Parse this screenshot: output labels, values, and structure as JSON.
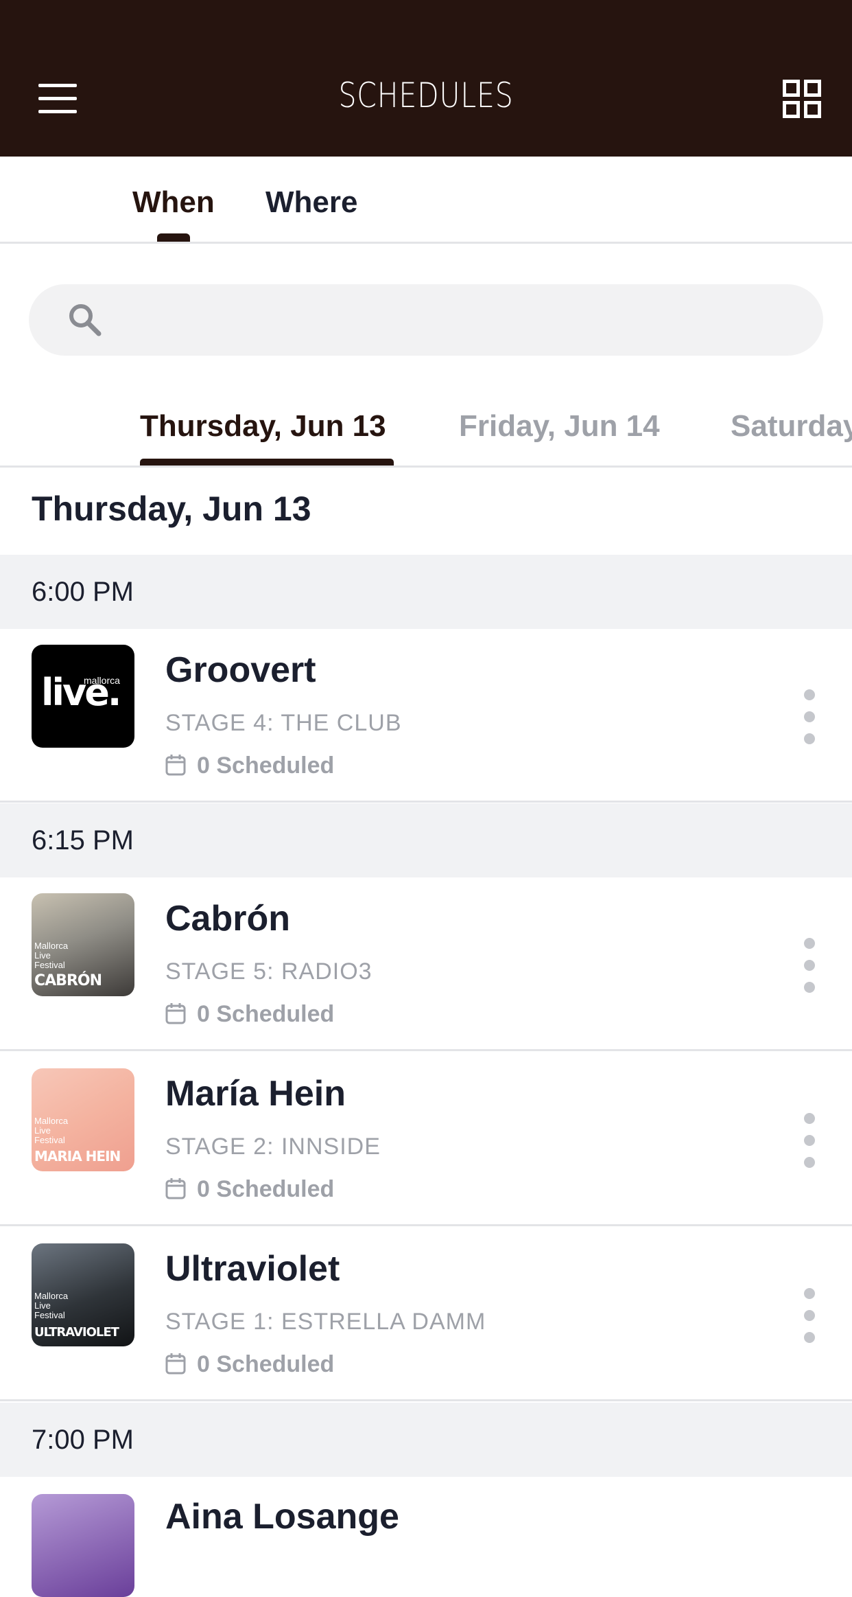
{
  "header": {
    "title": "SCHEDULES",
    "menu_icon": "hamburger-menu-icon",
    "grid_icon": "grid-view-icon",
    "background": "#26140f"
  },
  "mode_tabs": [
    {
      "label": "When",
      "active": true
    },
    {
      "label": "Where",
      "active": false
    }
  ],
  "search": {
    "placeholder": "",
    "value": ""
  },
  "day_tabs": [
    {
      "label": "Thursday, Jun 13",
      "active": true
    },
    {
      "label": "Friday, Jun 14",
      "active": false
    },
    {
      "label": "Saturday",
      "active": false
    }
  ],
  "day_heading": "Thursday, Jun 13",
  "groups": [
    {
      "time": "6:00 PM",
      "items": [
        {
          "name": "Groovert",
          "stage": "STAGE 4: THE CLUB",
          "scheduled": "0 Scheduled",
          "thumb": {
            "main": "live.",
            "small": "mallorca"
          }
        }
      ]
    },
    {
      "time": "6:15 PM",
      "items": [
        {
          "name": "Cabrón",
          "stage": "STAGE 5: RADIO3",
          "scheduled": "0 Scheduled",
          "thumb": {
            "small": "Mallorca Live Festival",
            "caption": "CABRÓN"
          }
        },
        {
          "name": "María Hein",
          "stage": "STAGE 2: INNSIDE",
          "scheduled": "0 Scheduled",
          "thumb": {
            "small": "Mallorca Live Festival",
            "caption": "MARIA HEIN"
          }
        },
        {
          "name": "Ultraviolet",
          "stage": "STAGE 1: ESTRELLA DAMM",
          "scheduled": "0 Scheduled",
          "thumb": {
            "small": "Mallorca Live Festival",
            "caption": "ULTRAVIOLET"
          }
        }
      ]
    },
    {
      "time": "7:00 PM",
      "items": [
        {
          "name": "Aina Losange",
          "stage": "",
          "scheduled": ""
        }
      ]
    }
  ],
  "colors": {
    "accent": "#26140f",
    "muted": "#9ea1a8",
    "section_bg": "#f1f2f4"
  }
}
